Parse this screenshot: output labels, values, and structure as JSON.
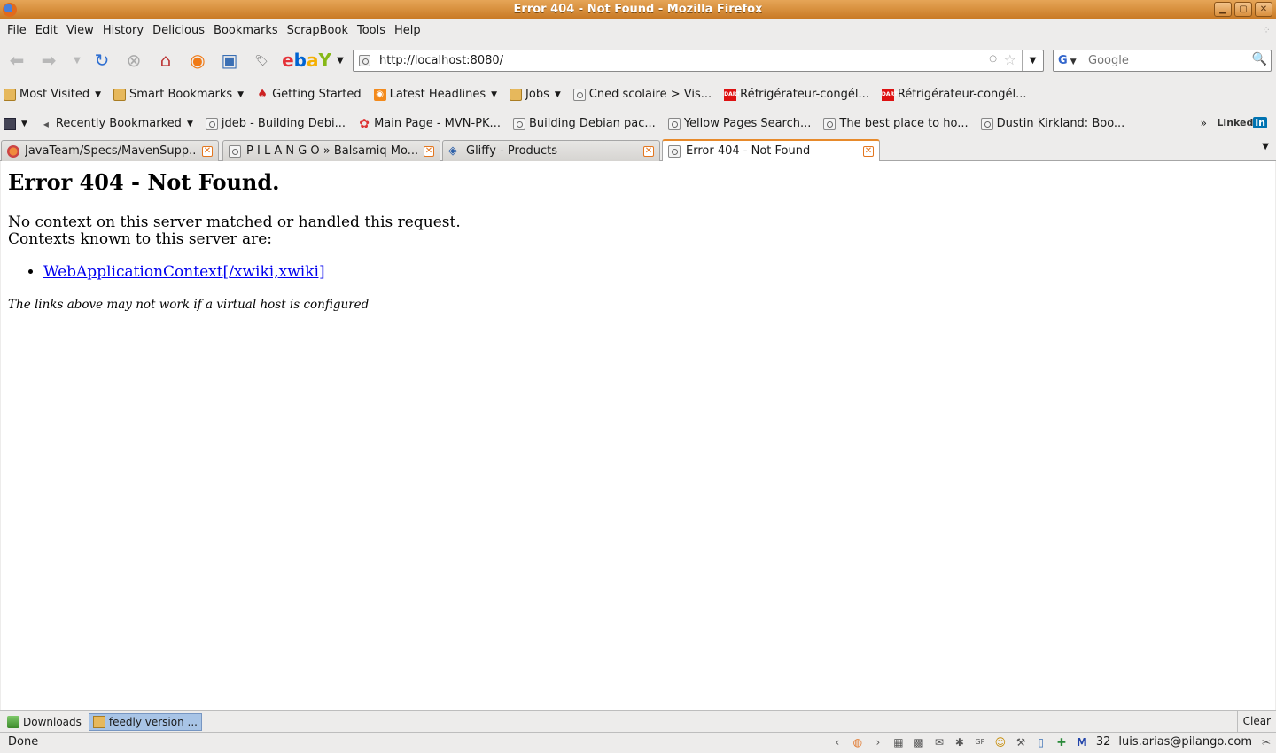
{
  "window": {
    "title": "Error 404 - Not Found - Mozilla Firefox",
    "minimize": "▁",
    "maximize": "▢",
    "close": "✕"
  },
  "menu": [
    "File",
    "Edit",
    "View",
    "History",
    "Delicious",
    "Bookmarks",
    "ScrapBook",
    "Tools",
    "Help"
  ],
  "nav": {
    "url": "http://localhost:8080/",
    "search_placeholder": "Google",
    "search_engine": "G"
  },
  "bookmarks_row1": [
    {
      "label": "Most Visited",
      "icon": "folder",
      "dropdown": true
    },
    {
      "label": "Smart Bookmarks",
      "icon": "folder",
      "dropdown": true
    },
    {
      "label": "Getting Started",
      "icon": "red"
    },
    {
      "label": "Latest Headlines",
      "icon": "rss",
      "dropdown": true
    },
    {
      "label": "Jobs",
      "icon": "folder",
      "dropdown": true
    },
    {
      "label": "Cned scolaire > Vis...",
      "icon": "page"
    },
    {
      "label": "Réfrigérateur-congél...",
      "icon": "darty"
    },
    {
      "label": "Réfrigérateur-congél...",
      "icon": "darty"
    }
  ],
  "bookmarks_row2": [
    {
      "label": "Recently Bookmarked",
      "icon": "tag",
      "dropdown": true
    },
    {
      "label": "jdeb - Building Debi...",
      "icon": "page"
    },
    {
      "label": "Main Page - MVN-PK...",
      "icon": "flower"
    },
    {
      "label": "Building Debian pac...",
      "icon": "page"
    },
    {
      "label": "Yellow Pages Search...",
      "icon": "page"
    },
    {
      "label": "The best place to ho...",
      "icon": "page"
    },
    {
      "label": "Dustin Kirkland: Boo...",
      "icon": "page"
    }
  ],
  "linkedin": {
    "text": "Linked",
    "badge": "in"
  },
  "tabs": [
    {
      "label": "JavaTeam/Specs/MavenSupp...",
      "active": false
    },
    {
      "label": "P I L A N G O » Balsamiq Mo...",
      "active": false
    },
    {
      "label": "Gliffy - Products",
      "active": false
    },
    {
      "label": "Error 404 - Not Found",
      "active": true
    }
  ],
  "page": {
    "heading": "Error 404 - Not Found.",
    "line1": "No context on this server matched or handled this request.",
    "line2": "Contexts known to this server are:",
    "link": "WebApplicationContext[/xwiki,xwiki]",
    "note": "The links above may not work if a virtual host is configured"
  },
  "downloads": {
    "items": [
      {
        "label": "Downloads",
        "active": false
      },
      {
        "label": "feedly version ...",
        "active": true
      }
    ],
    "clear": "Clear"
  },
  "status": {
    "text": "Done",
    "mail_count": "32",
    "account": "luis.arias@pilango.com"
  }
}
